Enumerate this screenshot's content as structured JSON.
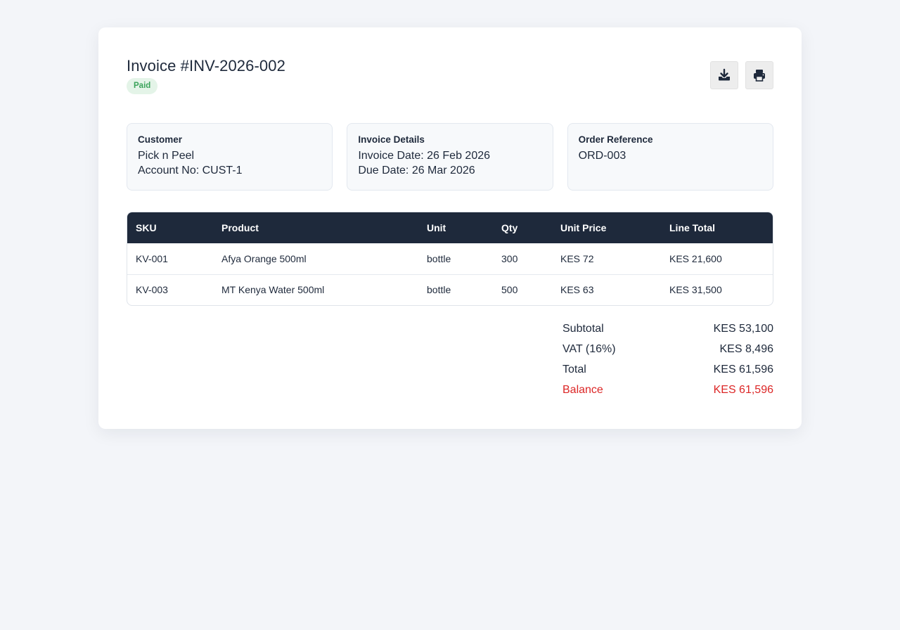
{
  "invoice": {
    "title": "Invoice #INV-2026-002",
    "status": "Paid"
  },
  "actions": {
    "download_icon": "download-icon",
    "print_icon": "print-icon"
  },
  "customer": {
    "label": "Customer",
    "name": "Pick n Peel",
    "account": "Account No: CUST-1"
  },
  "details": {
    "label": "Invoice Details",
    "invoice_date": "Invoice Date: 26 Feb 2026",
    "due_date": "Due Date: 26 Mar 2026"
  },
  "order": {
    "label": "Order Reference",
    "ref": "ORD-003"
  },
  "table": {
    "columns": [
      "SKU",
      "Product",
      "Unit",
      "Qty",
      "Unit Price",
      "Line Total"
    ],
    "rows": [
      [
        "KV-001",
        "Afya Orange 500ml",
        "bottle",
        "300",
        "KES 72",
        "KES 21,600"
      ],
      [
        "KV-003",
        "MT Kenya Water 500ml",
        "bottle",
        "500",
        "KES 63",
        "KES 31,500"
      ]
    ]
  },
  "totals": {
    "subtotal_label": "Subtotal",
    "subtotal_value": "KES 53,100",
    "vat_label": "VAT (16%)",
    "vat_value": "KES 8,496",
    "total_label": "Total",
    "total_value": "KES 61,596",
    "balance_label": "Balance",
    "balance_value": "KES 61,596"
  },
  "colors": {
    "header_bg": "#1e293b",
    "paid_badge": "#3aa35a",
    "balance": "#dc2626"
  }
}
